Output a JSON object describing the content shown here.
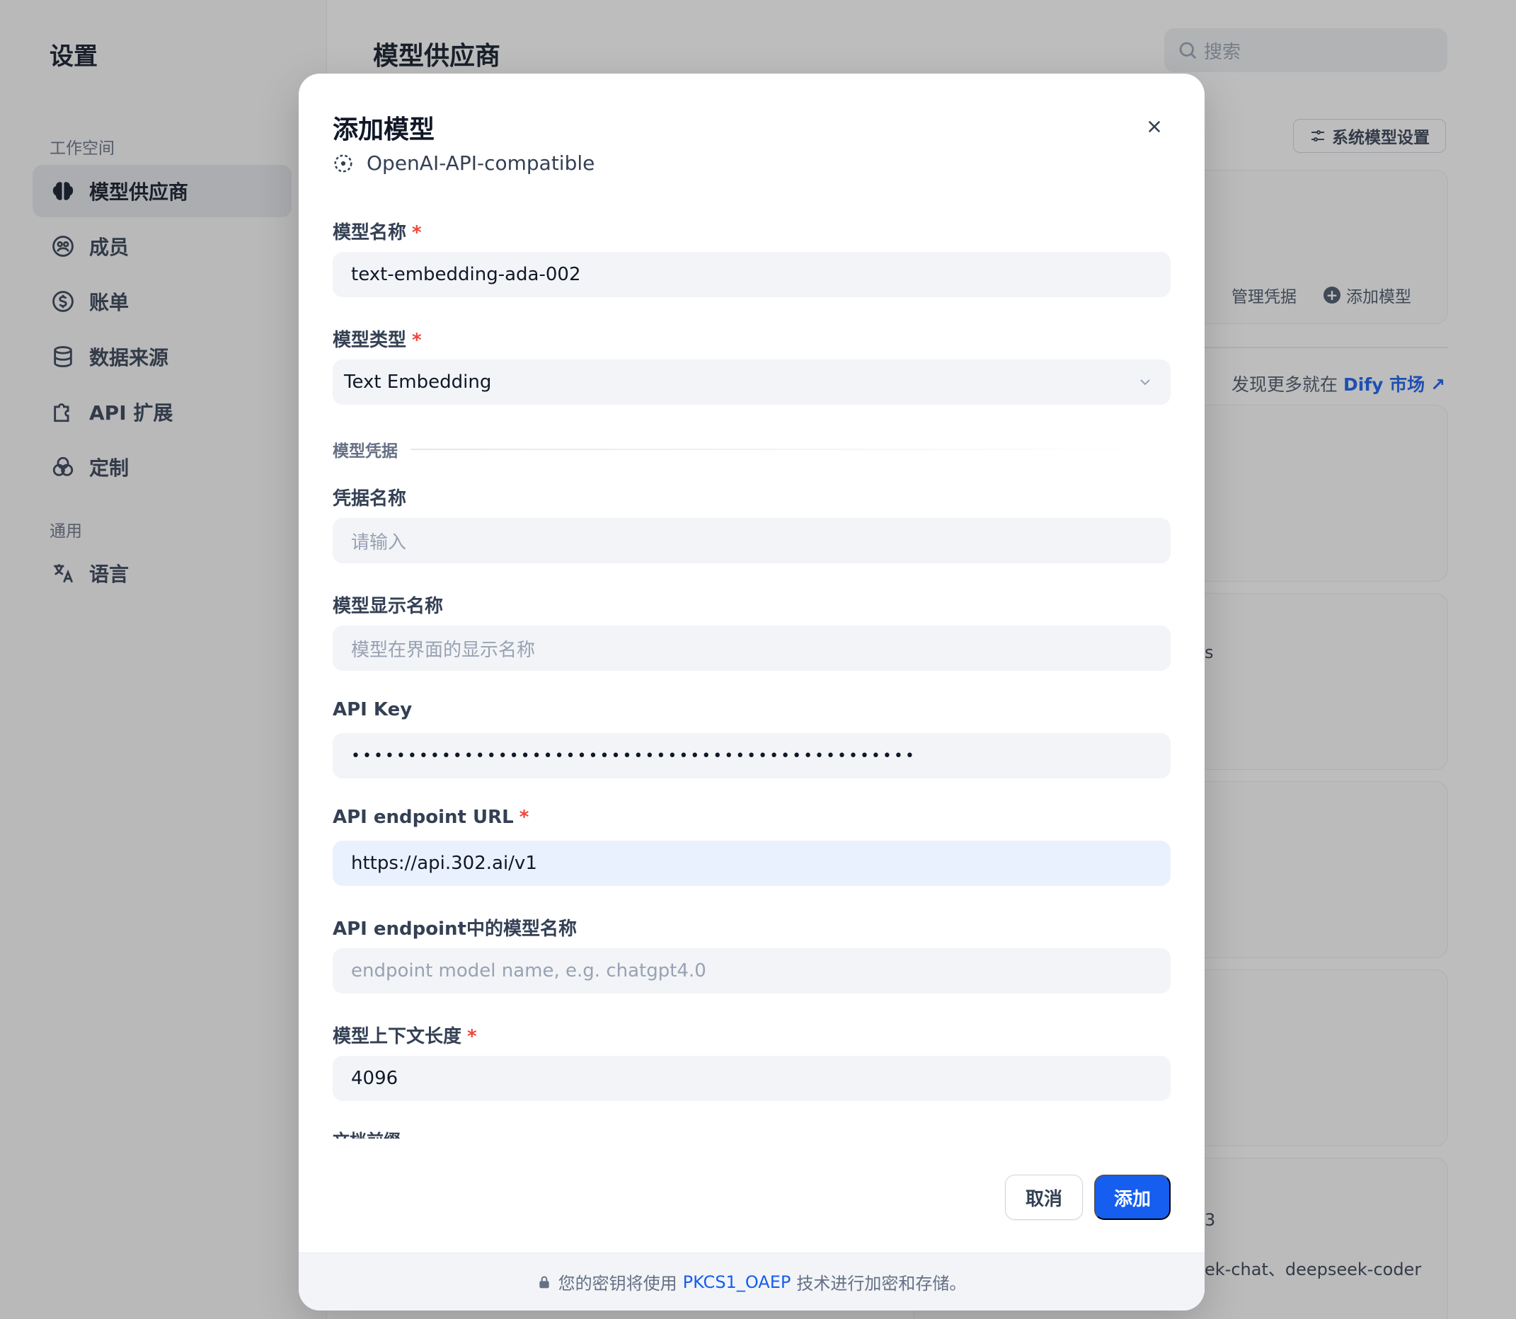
{
  "sidebar": {
    "title": "设置",
    "workspace_label": "工作空间",
    "general_label": "通用",
    "items": [
      {
        "label": "模型供应商",
        "icon": "brain-icon"
      },
      {
        "label": "成员",
        "icon": "team-icon"
      },
      {
        "label": "账单",
        "icon": "billing-icon"
      },
      {
        "label": "数据来源",
        "icon": "database-icon"
      },
      {
        "label": "API 扩展",
        "icon": "puzzle-icon"
      },
      {
        "label": "定制",
        "icon": "palette-icon"
      }
    ],
    "general_items": [
      {
        "label": "语言",
        "icon": "translate-icon"
      }
    ]
  },
  "main": {
    "title": "模型供应商",
    "search_placeholder": "搜索",
    "system_model_settings": "系统模型设置",
    "manage_credentials": "管理凭据",
    "add_model": "添加模型",
    "discover_more_prefix": "发现更多就在",
    "discover_more_link": "Dify 市场",
    "partial_text_1": "3",
    "partial_text_2": "ek-chat、deepseek-coder",
    "partial_text_3": "s"
  },
  "modal": {
    "title": "添加模型",
    "provider": "OpenAI-API-compatible",
    "fields": {
      "model_name": {
        "label": "模型名称",
        "value": "text-embedding-ada-002",
        "required": "*"
      },
      "model_type": {
        "label": "模型类型",
        "value": "Text Embedding",
        "required": "*"
      },
      "section": "模型凭据",
      "credential_name": {
        "label": "凭据名称",
        "placeholder": "请输入"
      },
      "display_name": {
        "label": "模型显示名称",
        "placeholder": "模型在界面的显示名称"
      },
      "api_key": {
        "label": "API Key",
        "value": "••••••••••••••••••••••••••••••••••••••••••••••••••"
      },
      "endpoint_url": {
        "label": "API endpoint URL",
        "value": "https://api.302.ai/v1",
        "required": "*"
      },
      "endpoint_model_name": {
        "label": "API endpoint中的模型名称",
        "placeholder": "endpoint model name, e.g. chatgpt4.0"
      },
      "context_size": {
        "label": "模型上下文长度",
        "value": "4096",
        "required": "*"
      },
      "doc_prefix": {
        "label": "文档前缀"
      }
    },
    "cancel": "取消",
    "submit": "添加",
    "footer": {
      "prefix": "您的密钥将使用",
      "link": "PKCS1_OAEP",
      "suffix": "技术进行加密和存储。"
    }
  },
  "colors": {
    "accent": "#155eef",
    "required": "#f04438",
    "input_bg": "#f2f4f7",
    "focus_bg": "#eaf1fe"
  }
}
